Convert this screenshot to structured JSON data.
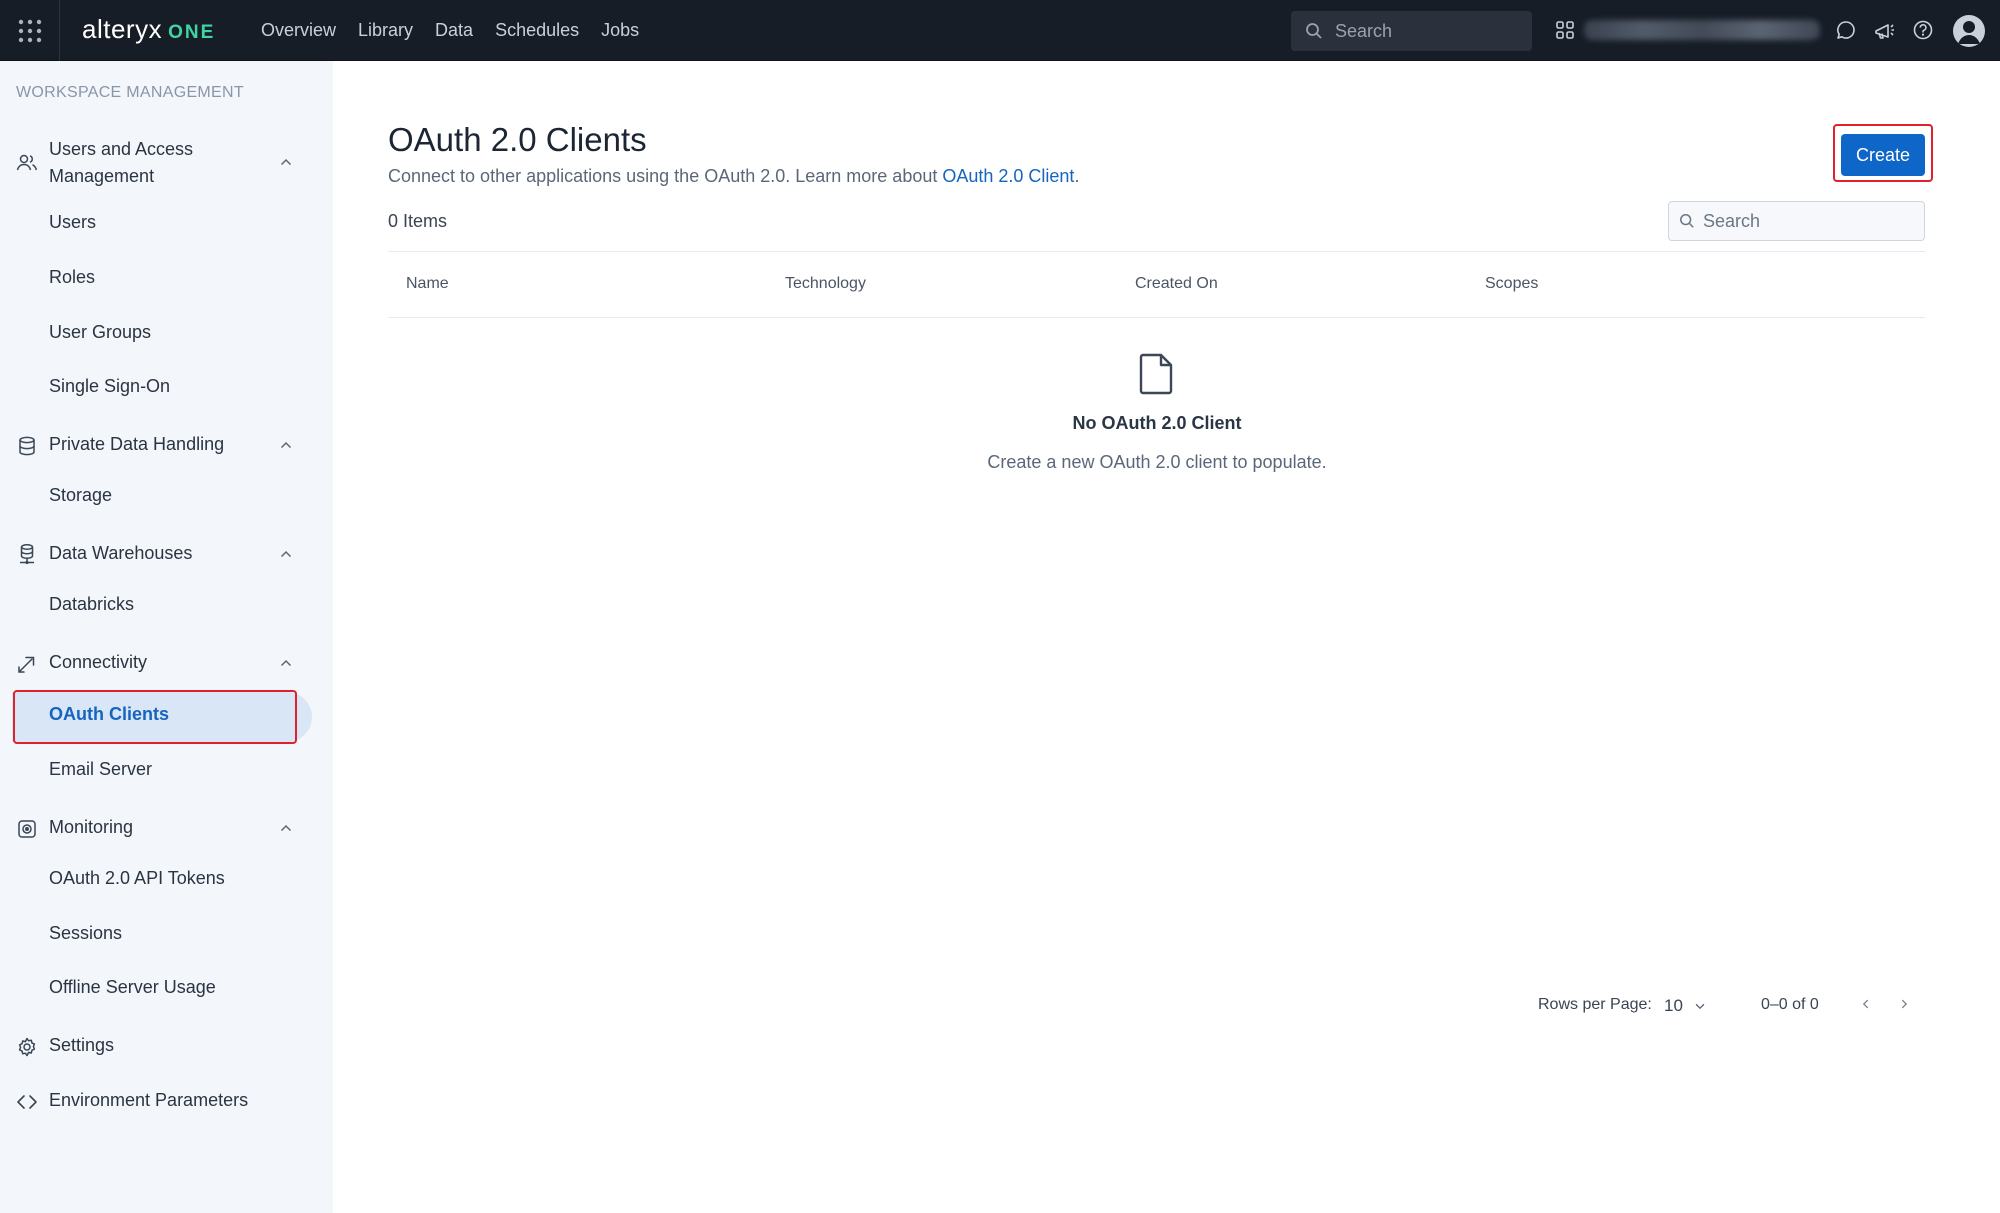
{
  "topbar": {
    "logo_text": "alteryx",
    "logo_suffix": "ONE",
    "nav": [
      "Overview",
      "Library",
      "Data",
      "Schedules",
      "Jobs"
    ],
    "search_placeholder": "Search"
  },
  "sidebar": {
    "title": "WORKSPACE MANAGEMENT",
    "sections": {
      "users_access": "Users and Access Management",
      "private_data": "Private Data Handling",
      "data_warehouses": "Data Warehouses",
      "connectivity": "Connectivity",
      "monitoring": "Monitoring",
      "settings": "Settings",
      "env_params": "Environment Parameters"
    },
    "items": {
      "users": "Users",
      "roles": "Roles",
      "user_groups": "User Groups",
      "sso": "Single Sign-On",
      "storage": "Storage",
      "databricks": "Databricks",
      "oauth_clients": "OAuth Clients",
      "email_server": "Email Server",
      "oauth_tokens": "OAuth 2.0 API Tokens",
      "sessions": "Sessions",
      "offline_usage": "Offline Server Usage"
    }
  },
  "main": {
    "title": "OAuth 2.0 Clients",
    "subtitle_prefix": "Connect to other applications using the OAuth 2.0. Learn more about ",
    "subtitle_link": "OAuth 2.0 Client",
    "subtitle_suffix": ".",
    "create_label": "Create",
    "items_count": "0 Items",
    "search_placeholder": "Search",
    "columns": [
      "Name",
      "Technology",
      "Created On",
      "Scopes"
    ],
    "empty_title": "No OAuth 2.0 Client",
    "empty_subtitle": "Create a new OAuth 2.0 client to populate.",
    "rows_per_page_label": "Rows per Page:",
    "rows_per_page_value": "10",
    "range_text": "0–0 of 0"
  },
  "colors": {
    "topbar_bg": "#171d27",
    "accent": "#0f66c9",
    "logo_one": "#3fd5a3",
    "highlight_border": "#e0202a",
    "sidebar_bg": "#f3f6fb"
  }
}
